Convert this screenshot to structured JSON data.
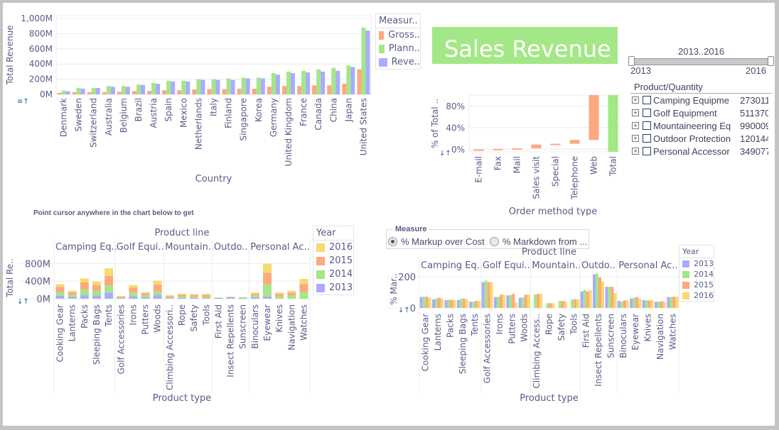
{
  "title": "Sales Revenue",
  "colors": {
    "gross": "#fea87e",
    "planned": "#a4e786",
    "revenue": "#a9acfe",
    "y2013": "#a9acfe",
    "y2014": "#a4e786",
    "y2015": "#fea87e",
    "y2016": "#f7da6e",
    "title_bg": "#a4e786"
  },
  "slider": {
    "range_label": "2013..2016",
    "min_label": "2013",
    "max_label": "2016",
    "min": 2013,
    "max": 2016,
    "selected_min": 2013,
    "selected_max": 2016
  },
  "tree": {
    "header": "Product/Quantity",
    "rows": [
      {
        "name": "Camping Equipme",
        "value": "273011"
      },
      {
        "name": "Golf Equipment",
        "value": "511370"
      },
      {
        "name": "Mountaineering Eq",
        "value": "990009"
      },
      {
        "name": "Outdoor Protection",
        "value": "120144"
      },
      {
        "name": "Personal Accessor",
        "value": "349077"
      }
    ]
  },
  "hint_text": "Point cursor anywhere in the chart below to get",
  "measure": {
    "caption": "Measure",
    "options": [
      "% Markup over Cost",
      "% Markdown from ..."
    ],
    "selected": 0
  },
  "icons": {
    "sort1": "≡↑",
    "sort2": "↓↑"
  },
  "chart_data": [
    {
      "type": "bar",
      "title": "",
      "xlabel": "Country",
      "ylabel": "Total Revenue",
      "ylim": [
        0,
        1000
      ],
      "yticks": [
        "0M",
        "200M",
        "400M",
        "600M",
        "800M",
        "1,000M"
      ],
      "yticks_values": [
        0,
        200,
        400,
        600,
        800,
        1000
      ],
      "legend_title": "Measur..",
      "legend": [
        "Gross..",
        "Plann..",
        "Reve.."
      ],
      "categories": [
        "Denmark",
        "Sweden",
        "Switzerland",
        "Australia",
        "Belgium",
        "Brazil",
        "Austria",
        "Spain",
        "Mexico",
        "Netherlands",
        "Italy",
        "Finland",
        "Singapore",
        "Korea",
        "Germany",
        "United Kingdom",
        "France",
        "Canada",
        "China",
        "Japan",
        "United States"
      ],
      "series": [
        {
          "name": "Gross Profit",
          "values": [
            20,
            30,
            30,
            30,
            35,
            45,
            45,
            55,
            55,
            65,
            70,
            70,
            75,
            75,
            100,
            110,
            110,
            120,
            120,
            140,
            330
          ]
        },
        {
          "name": "Planned Revenue",
          "values": [
            50,
            85,
            85,
            110,
            110,
            130,
            150,
            180,
            180,
            200,
            200,
            210,
            220,
            220,
            280,
            300,
            310,
            330,
            350,
            380,
            880
          ]
        },
        {
          "name": "Revenue",
          "values": [
            40,
            75,
            85,
            100,
            100,
            125,
            140,
            170,
            170,
            190,
            190,
            190,
            210,
            210,
            260,
            280,
            290,
            300,
            310,
            360,
            840
          ]
        }
      ]
    },
    {
      "type": "bar",
      "subtype": "waterfall",
      "xlabel": "Order method type",
      "ylabel": "% of Total ..",
      "ylim": [
        -5,
        100
      ],
      "yticks": [
        "0%",
        "40%",
        "80%"
      ],
      "yticks_values": [
        0,
        40,
        80
      ],
      "categories": [
        "E-mail",
        "Fax",
        "Mail",
        "Sales visit",
        "Special",
        "Telephone",
        "Web",
        "Total"
      ],
      "values": [
        2.5,
        1.0,
        1.0,
        7.0,
        1.5,
        7.0,
        85.0,
        100.0
      ]
    },
    {
      "type": "bar",
      "subtype": "stacked",
      "title": "Product line",
      "xlabel": "Product type",
      "ylabel": "Total Re..",
      "ylim": [
        0,
        950
      ],
      "yticks": [
        "0M",
        "400M",
        "800M"
      ],
      "yticks_values": [
        0,
        400,
        800
      ],
      "legend_title": "Year",
      "legend": [
        "2016",
        "2015",
        "2014",
        "2013"
      ],
      "groups": [
        {
          "name": "Camping Eq..",
          "categories": [
            "Cooking Gear",
            "Lanterns",
            "Packs",
            "Sleeping Bags",
            "Tents"
          ]
        },
        {
          "name": "Golf Equi..",
          "categories": [
            "Golf Accessories",
            "Irons",
            "Putters",
            "Woods"
          ]
        },
        {
          "name": "Mountain..",
          "categories": [
            "Climbing Accessori..",
            "Rope",
            "Safety",
            "Tools"
          ]
        },
        {
          "name": "Outdo..",
          "categories": [
            "First Aid",
            "Insect Repellents",
            "Sunscreen"
          ]
        },
        {
          "name": "Personal Ac..",
          "categories": [
            "Binoculars",
            "Eyewear",
            "Knives",
            "Navigation",
            "Watches"
          ]
        }
      ],
      "series": [
        {
          "name": "2013",
          "values": [
            70,
            40,
            80,
            75,
            140,
            15,
            60,
            30,
            80,
            10,
            20,
            20,
            10,
            20,
            35,
            15,
            30,
            55
          ]
        },
        {
          "name": "2014",
          "values": [
            80,
            50,
            130,
            110,
            160,
            15,
            80,
            45,
            90,
            20,
            30,
            25,
            30,
            5,
            5,
            10,
            40,
            270,
            50,
            70,
            160
          ]
        },
        {
          "name": "2015",
          "values": [
            120,
            60,
            160,
            120,
            220,
            20,
            110,
            50,
            150,
            30,
            40,
            40,
            45,
            2,
            5,
            5,
            40,
            260,
            60,
            70,
            170
          ]
        },
        {
          "name": "2016",
          "values": [
            60,
            30,
            90,
            80,
            170,
            10,
            60,
            25,
            90,
            20,
            25,
            20,
            25,
            2,
            5,
            5,
            30,
            210,
            30,
            40,
            120
          ]
        }
      ]
    },
    {
      "type": "bar",
      "subtype": "grouped",
      "title": "Product line",
      "xlabel": "Product type",
      "ylabel": "% Mar..",
      "ylim": [
        0,
        240
      ],
      "yticks": [
        "0",
        "200"
      ],
      "yticks_values": [
        0,
        200
      ],
      "legend_title": "Year",
      "legend": [
        "2013",
        "2014",
        "2015",
        "2016"
      ],
      "groups": [
        {
          "name": "Camping Eq..",
          "categories": [
            "Cooking Gear",
            "Lanterns",
            "Packs",
            "Sleeping Bags",
            "Tents"
          ]
        },
        {
          "name": "Golf Equi..",
          "categories": [
            "Golf Accessories",
            "Irons",
            "Putters",
            "Woods"
          ]
        },
        {
          "name": "Mountain..",
          "categories": [
            "Climbing Access..",
            "Rope",
            "Safety",
            "Tools"
          ]
        },
        {
          "name": "Outdo..",
          "categories": [
            "First Aid",
            "Insect Repellents",
            "Sunscreen"
          ]
        },
        {
          "name": "Personal Ac..",
          "categories": [
            "Binoculars",
            "Eyewear",
            "Knives",
            "Navigation",
            "Watches"
          ]
        }
      ],
      "series": [
        {
          "name": "2013",
          "values": [
            70,
            55,
            50,
            50,
            40,
            165,
            70,
            80,
            65,
            null,
            null,
            null,
            null,
            105,
            215,
            135,
            45,
            60,
            50,
            40,
            70
          ]
        },
        {
          "name": "2014",
          "values": [
            72,
            60,
            52,
            58,
            40,
            175,
            70,
            82,
            68,
            85,
            30,
            45,
            55,
            115,
            220,
            135,
            42,
            65,
            48,
            40,
            70
          ]
        },
        {
          "name": "2015",
          "values": [
            72,
            65,
            52,
            60,
            45,
            165,
            85,
            90,
            85,
            90,
            30,
            45,
            55,
            105,
            195,
            135,
            48,
            70,
            48,
            42,
            72
          ]
        },
        {
          "name": "2016",
          "values": [
            65,
            58,
            50,
            55,
            45,
            165,
            85,
            35,
            85,
            90,
            30,
            42,
            55,
            115,
            170,
            95,
            50,
            60,
            50,
            40,
            72
          ]
        }
      ]
    }
  ]
}
